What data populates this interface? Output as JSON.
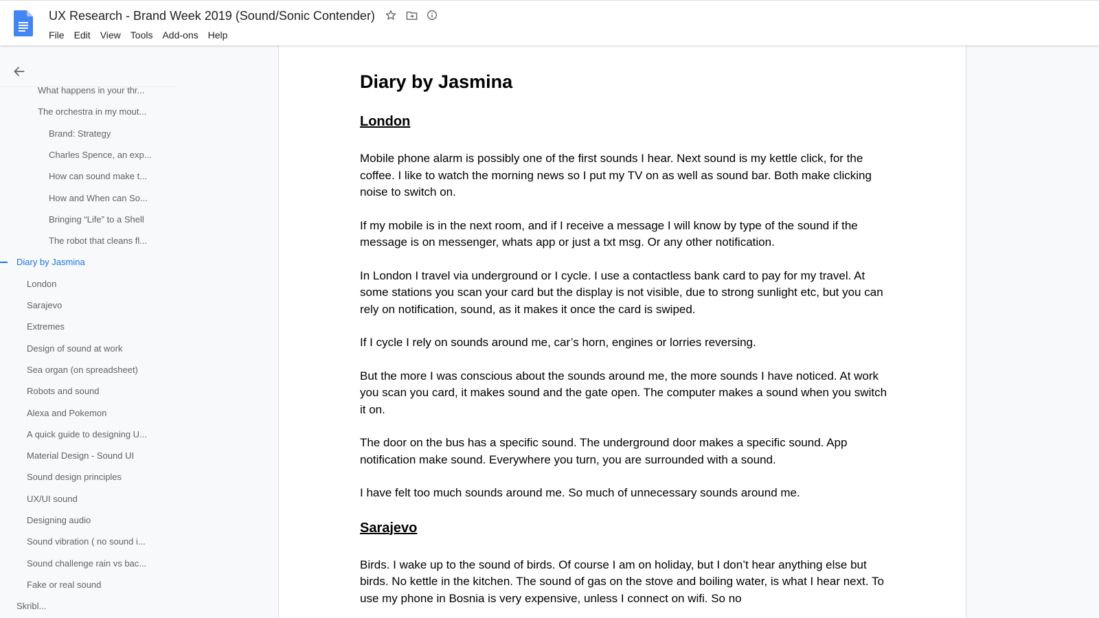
{
  "app": {
    "doc_title": "UX Research - Brand Week 2019 (Sound/Sonic Contender)",
    "icons": [
      "star-icon",
      "move-to-folder-icon",
      "info-icon"
    ],
    "accent_color": "#1a73e8",
    "logo_color": "#4285f4"
  },
  "menu": {
    "items": [
      "File",
      "Edit",
      "View",
      "Tools",
      "Add-ons",
      "Help"
    ]
  },
  "outline": {
    "items": [
      {
        "label": "What happens in your thr...",
        "level": 1
      },
      {
        "label": "The orchestra in my mout...",
        "level": 1
      },
      {
        "label": "Brand: Strategy",
        "level": 2
      },
      {
        "label": "Charles Spence, an exp...",
        "level": 2
      },
      {
        "label": "How can sound make t...",
        "level": 2
      },
      {
        "label": "How and When can So...",
        "level": 2
      },
      {
        "label": "Bringing “Life” to a Shell",
        "level": 2
      },
      {
        "label": "The robot that cleans fl...",
        "level": 2
      },
      {
        "label": "Diary by Jasmina",
        "level": 0,
        "active": true
      },
      {
        "label": "London",
        "level": 1
      },
      {
        "label": "Sarajevo",
        "level": 1
      },
      {
        "label": "Extremes",
        "level": 1
      },
      {
        "label": "Design of sound at work",
        "level": 1
      },
      {
        "label": "Sea organ (on spreadsheet)",
        "level": 1
      },
      {
        "label": "Robots and sound",
        "level": 1
      },
      {
        "label": "Alexa and Pokemon",
        "level": 1
      },
      {
        "label": "A quick guide to designing U...",
        "level": 1
      },
      {
        "label": "Material Design - Sound UI",
        "level": 1
      },
      {
        "label": "Sound design principles",
        "level": 1
      },
      {
        "label": "UX/UI sound",
        "level": 1
      },
      {
        "label": "Designing audio",
        "level": 1
      },
      {
        "label": "Sound vibration ( no sound i...",
        "level": 1
      },
      {
        "label": "Sound challenge rain vs bac...",
        "level": 1
      },
      {
        "label": "Fake or real sound",
        "level": 1
      },
      {
        "label": "Skribl...",
        "level": 0
      }
    ]
  },
  "document": {
    "heading": "Diary by Jasmina",
    "sections": [
      {
        "title": "London",
        "paragraphs": [
          "Mobile phone alarm is possibly one of the first sounds I hear. Next sound is my kettle click, for the coffee. I like to watch the morning news so I put my TV on as well as sound bar. Both make clicking noise to switch on.",
          "If my mobile is in the next room, and if I receive a message I will know by type of the sound if the message is on messenger, whats app or just a txt msg. Or any other notification.",
          "In London I travel via underground or I cycle. I use a contactless bank card to pay for my travel. At some stations you scan your card but the display is not visible, due to strong sunlight etc, but you can rely on notification, sound, as it makes it once the card is swiped.",
          "If I cycle I rely on sounds around me, car’s horn, engines or lorries reversing.",
          "But the more I was conscious about the sounds around me, the more sounds I have noticed. At work you scan you card, it makes sound and the gate open. The computer makes a sound when you switch it on.",
          "The door on the bus has a specific sound. The underground door makes  a specific sound. App notification make sound.  Everywhere you turn, you are surrounded with a sound.",
          "I have felt too much sounds around me. So much of unnecessary sounds around me."
        ]
      },
      {
        "title": "Sarajevo",
        "paragraphs": [
          "Birds. I wake up to the sound of birds. Of course I am on holiday, but I don’t hear anything else but birds. No kettle in the kitchen. The sound of gas on the stove and boiling water, is what I hear next. To use my phone in Bosnia is very expensive, unless I connect on wifi. So no"
        ]
      }
    ]
  }
}
